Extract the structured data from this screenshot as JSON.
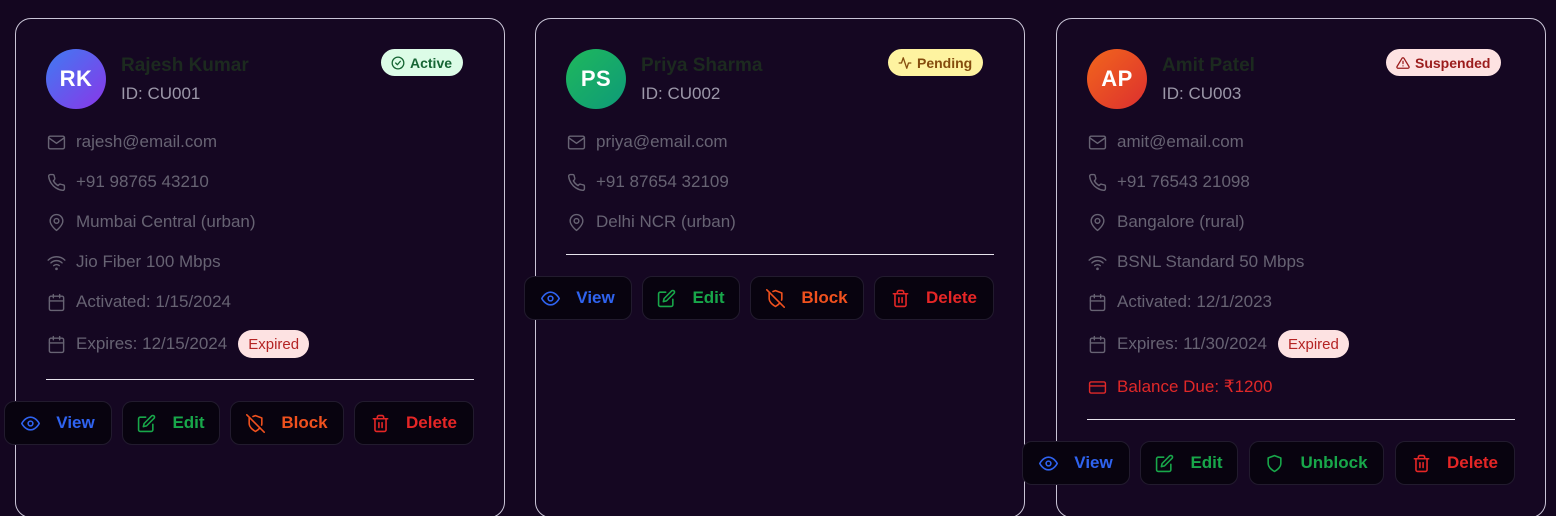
{
  "customers": [
    {
      "initials": "RK",
      "name": "Rajesh Kumar",
      "id_text": "ID: CU001",
      "status": "Active",
      "email": "rajesh@email.com",
      "phone": "+91 98765 43210",
      "location": "Mumbai Central (urban)",
      "plan": "Jio Fiber 100 Mbps",
      "activated": "Activated: 1/15/2024",
      "expires": "Expires: 12/15/2024",
      "expired_badge": "Expired",
      "actions": [
        "View",
        "Edit",
        "Block",
        "Delete"
      ]
    },
    {
      "initials": "PS",
      "name": "Priya Sharma",
      "id_text": "ID: CU002",
      "status": "Pending",
      "email": "priya@email.com",
      "phone": "+91 87654 32109",
      "location": "Delhi NCR (urban)",
      "actions": [
        "View",
        "Edit",
        "Block",
        "Delete"
      ]
    },
    {
      "initials": "AP",
      "name": "Amit Patel",
      "id_text": "ID: CU003",
      "status": "Suspended",
      "email": "amit@email.com",
      "phone": "+91 76543 21098",
      "location": "Bangalore (rural)",
      "plan": "BSNL Standard 50 Mbps",
      "activated": "Activated: 12/1/2023",
      "expires": "Expires: 11/30/2024",
      "expired_badge": "Expired",
      "balance": "Balance Due: ₹1200",
      "actions": [
        "View",
        "Edit",
        "Unblock",
        "Delete"
      ]
    }
  ],
  "colors": {
    "background": "#140620",
    "active_badge_bg": "#dcfce7",
    "pending_badge_bg": "#fef3a0",
    "suspended_badge_bg": "#fde2e2",
    "view": "#2f63f0",
    "edit": "#18a74a",
    "block": "#f0511e",
    "delete": "#e52626"
  },
  "icons": [
    "check-circle-icon",
    "activity-icon",
    "alert-triangle-icon",
    "mail-icon",
    "phone-icon",
    "map-pin-icon",
    "wifi-icon",
    "calendar-icon",
    "credit-card-icon",
    "eye-icon",
    "edit-icon",
    "shield-off-icon",
    "shield-icon",
    "trash-icon"
  ]
}
